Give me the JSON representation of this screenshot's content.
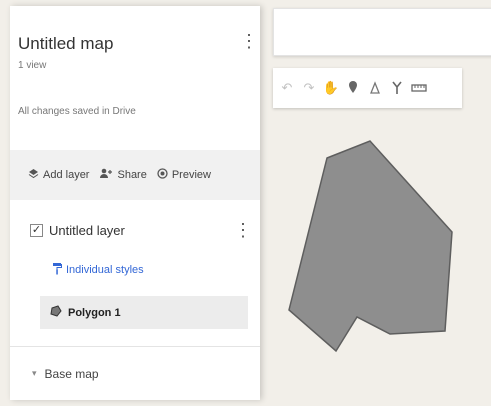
{
  "map": {
    "title": "Untitled map",
    "views": "1 view",
    "saved_status": "All changes saved in Drive",
    "menu_icon": "more-vert-icon"
  },
  "actions": {
    "add_layer": "Add layer",
    "share": "Share",
    "preview": "Preview"
  },
  "layer": {
    "name": "Untitled layer",
    "checked": true,
    "style_label": "Individual styles",
    "features": [
      {
        "label": "Polygon 1"
      }
    ]
  },
  "base_map": {
    "label": "Base map"
  },
  "toolbar": {
    "tools": [
      "undo-icon",
      "redo-icon",
      "hand-icon",
      "marker-icon",
      "draw-line-icon",
      "route-icon",
      "ruler-icon"
    ]
  },
  "colors": {
    "polygon_fill": "#8e8e8e",
    "polygon_stroke": "#5e5e5e",
    "map_background": "#f2efe9",
    "link_blue": "#3367d6"
  }
}
